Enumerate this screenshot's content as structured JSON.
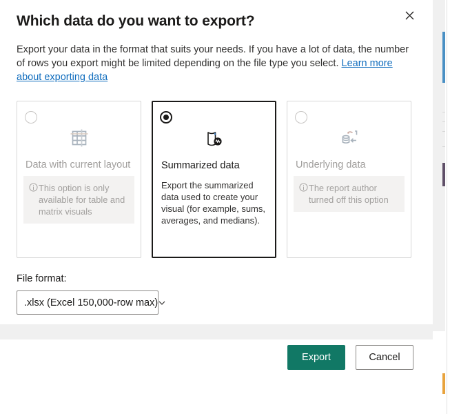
{
  "dialog": {
    "title": "Which data do you want to export?",
    "description_part1": "Export your data in the format that suits your needs. If you have a lot of data, the number of rows you export might be limited depending on the file type you select. ",
    "description_link": "Learn more about exporting data",
    "close_label": "Close",
    "close_icon": "close-icon"
  },
  "options": [
    {
      "id": "data-with-current-layout",
      "label": "Data with current layout",
      "icon": "table-grid-icon",
      "selected": false,
      "disabled": true,
      "info_text": "This option is only available for table and matrix visuals",
      "info_icon": "info-icon",
      "description": ""
    },
    {
      "id": "summarized-data",
      "label": "Summarized data",
      "icon": "summarized-data-icon",
      "selected": true,
      "disabled": false,
      "info_text": "",
      "info_icon": "",
      "description": "Export the summarized data used to create your visual (for example, sums, averages, and medians)."
    },
    {
      "id": "underlying-data",
      "label": "Underlying data",
      "icon": "database-arrow-icon",
      "selected": false,
      "disabled": true,
      "info_text": "The report author turned off this option",
      "info_icon": "info-icon",
      "description": ""
    }
  ],
  "file_format": {
    "label": "File format:",
    "selected_value": ".xlsx (Excel 150,000-row max)",
    "chevron_icon": "chevron-down-icon"
  },
  "footer": {
    "export_label": "Export",
    "cancel_label": "Cancel"
  },
  "colors": {
    "accent": "#117865",
    "link": "#0f6cbd",
    "disabled_text": "#a19f9d",
    "info_background": "#f3f2f1",
    "card_border": "#d6d6d6",
    "selected_border": "#1b1a19"
  }
}
